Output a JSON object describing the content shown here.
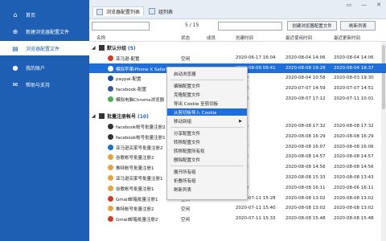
{
  "window": {
    "controls": [
      "▭",
      "—",
      "✕"
    ]
  },
  "sidebar": {
    "items": [
      {
        "label": "首页",
        "icon": "home-icon",
        "active": false
      },
      {
        "label": "新建浏览器配置文件",
        "icon": "add-circle-icon",
        "active": false
      },
      {
        "label": "浏览器配置文件",
        "icon": "list-icon",
        "active": true
      },
      {
        "label": "我的账户",
        "icon": "user-icon",
        "active": false
      },
      {
        "label": "帮助与支持",
        "icon": "help-icon",
        "active": false
      }
    ]
  },
  "tabs": [
    {
      "label": "浏览器配置列表",
      "active": true
    },
    {
      "label": "组列表",
      "active": false
    }
  ],
  "toolbar": {
    "search_placeholder": "",
    "count": "5 / 15",
    "create_button": "创建浏览器配置文件",
    "refresh_button": "刷新列表"
  },
  "columns": [
    "名称",
    "状态",
    "成员",
    "创建时间",
    "最近使用时间",
    "最近更新时间"
  ],
  "groups": [
    {
      "name": "默认分组",
      "count": "(5)"
    },
    {
      "name": "批量注册帐号",
      "count": "(10)"
    }
  ],
  "rows": [
    {
      "name": "亚马逊-配置",
      "status": "空闲",
      "created": "2020-06-17 16:04",
      "last": "2020-08-04 14:06",
      "updated": "2020-08-04 14:06",
      "icon_color": "#d23a2a"
    },
    {
      "name": "模拟苹果iPhone X Safari...",
      "status": "",
      "created": "2020-08-09 09:41",
      "last": "2020-08-08 19:28",
      "updated": "2020-08-04 18:37",
      "icon_color": "#ffffff",
      "selected": true
    },
    {
      "name": "paypal-配置",
      "status": "",
      "created": "10:59",
      "last": "2020-08-04 10:58",
      "updated": "2020-08-03 19:30",
      "icon_color": "#1c4fa0"
    },
    {
      "name": "facebook-配置",
      "status": "",
      "created": "10:58",
      "last": "2020-07-07 14:59",
      "updated": "2020-07-07 14:51",
      "icon_color": "#3b5998"
    },
    {
      "name": "模拟电脑Chrome浏览器",
      "status": "",
      "created": "10:48",
      "last": "2020-08-07 17:12",
      "updated": "2020-07-11 10:01",
      "icon_color": "#4caf50"
    },
    {
      "name": "facebook帐号批量注册2",
      "status": "",
      "created": "17:06",
      "last": "2020-08-08 17:32",
      "updated": "2020-08-08 17:32",
      "icon_color": "#333333"
    },
    {
      "name": "facebook帐号批量注册1",
      "status": "",
      "created": "16:31",
      "last": "2020-08-08 16:29",
      "updated": "2020-08-08 16:29",
      "icon_color": "#333333"
    },
    {
      "name": "亚马逊买家号批量注册2",
      "status": "",
      "created": "16:07",
      "last": "2020-08-08 16:07",
      "updated": "2020-08-08 16:06",
      "icon_color": "#1c6fd0"
    },
    {
      "name": "谷歌帐号批量注册2",
      "status": "",
      "created": "15:55",
      "last": "2020-08-08 14:57",
      "updated": "2020-08-08 14:57",
      "icon_color": "#e9a23b"
    },
    {
      "name": "推特帐号批量注册1",
      "status": "",
      "created": "15:52",
      "last": "2020-08-08 14:56",
      "updated": "2020-08-08 14:56",
      "icon_color": "#e9a23b"
    },
    {
      "name": "亚马逊买家号批量注册1",
      "status": "",
      "created": "15:01",
      "last": "2020-08-08 15:33",
      "updated": "2020-08-08 13:43",
      "icon_color": "#e9a23b"
    },
    {
      "name": "谷歌帐号批量注册1",
      "status": "",
      "created": "15:30",
      "last": "2020-08-08 16:11",
      "updated": "2020-08-06 16:11",
      "icon_color": "#e9a23b"
    },
    {
      "name": "Gmail邮箱批量注册1",
      "status": "空闲",
      "created": "2020-07-11 15:28",
      "last": "2020-08-08 13:02",
      "updated": "2020-08-08 13:02",
      "icon_color": "#d23a2a"
    },
    {
      "name": "推特帐号批量注册2",
      "status": "空闲",
      "created": "2020-07-11 15:40",
      "last": "2020-08-08 13:02",
      "updated": "2020-08-08 13:02",
      "icon_color": "#e9a23b"
    },
    {
      "name": "Gmail邮箱批量注册2",
      "status": "空闲",
      "created": "2020-07-11 15:33",
      "last": "2020-08-08 15:48",
      "updated": "2020-08-08 15:48",
      "icon_color": "#d23a2a"
    }
  ],
  "context_menu": [
    "启动浏览器",
    "编辑配置文件",
    "克隆配置文件",
    "导出 Cookie 至剪切板",
    "从剪切板导入 Cookie",
    "移动到组",
    "分享配置文件",
    "转移配置文件",
    "转移配置所有权",
    "删除配置文件",
    "展开所有组",
    "折叠所有组",
    "刷新列表"
  ]
}
